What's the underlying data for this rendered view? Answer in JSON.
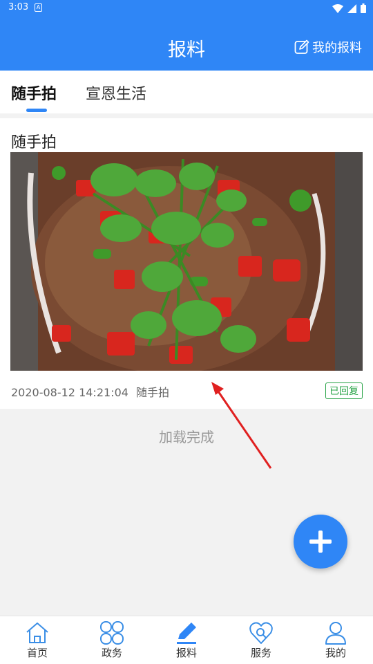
{
  "status_bar": {
    "time": "3:03",
    "notification": "A"
  },
  "header": {
    "title": "报料",
    "my_reports": "我的报料"
  },
  "tabs": [
    {
      "label": "随手拍",
      "active": true
    },
    {
      "label": "宣恩生活",
      "active": false
    }
  ],
  "post": {
    "title": "随手拍",
    "timestamp": "2020-08-12 14:21:04",
    "category": "随手拍",
    "status_badge": "已回复"
  },
  "load_status": "加载完成",
  "fab": {
    "icon": "plus-icon"
  },
  "bottom_nav": [
    {
      "label": "首页",
      "icon": "home-icon"
    },
    {
      "label": "政务",
      "icon": "clover-icon"
    },
    {
      "label": "报料",
      "icon": "pen-icon"
    },
    {
      "label": "服务",
      "icon": "service-heart-icon"
    },
    {
      "label": "我的",
      "icon": "person-icon"
    }
  ],
  "colors": {
    "primary": "#2f86f6",
    "badge_green": "#25a244",
    "annotation_arrow": "#e02020"
  }
}
